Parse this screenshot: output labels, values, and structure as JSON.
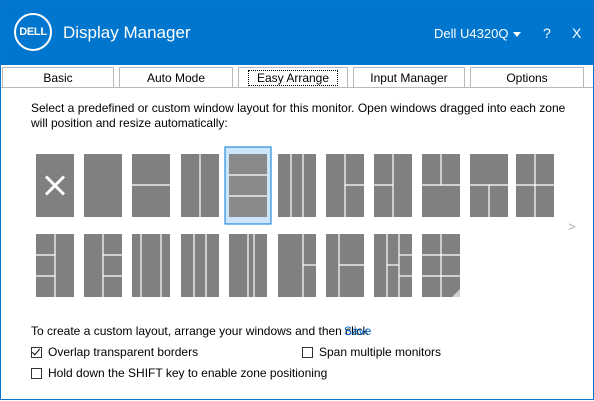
{
  "window": {
    "logo_text": "DELL",
    "title": "Display Manager",
    "monitor": "Dell U4320Q",
    "help_label": "?",
    "close_label": "X"
  },
  "tabs": [
    {
      "label": "Basic",
      "active": false
    },
    {
      "label": "Auto Mode",
      "active": false
    },
    {
      "label": "Easy Arrange",
      "active": true
    },
    {
      "label": "Input Manager",
      "active": false
    },
    {
      "label": "Options",
      "active": false
    }
  ],
  "description": "Select a predefined or custom window layout for this monitor.  Open windows dragged into each zone will position and resize automatically:",
  "layouts": {
    "selected_index": 4,
    "rows": 2,
    "per_row": [
      11,
      9
    ]
  },
  "next_arrow": ">",
  "custom_layout_text": "To create a custom layout, arrange your windows and then click",
  "save_label": "Save",
  "checkboxes": {
    "overlap": {
      "label": "Overlap transparent borders",
      "checked": true
    },
    "span": {
      "label": "Span multiple monitors",
      "checked": false
    },
    "shift": {
      "label": "Hold down the SHIFT key to enable zone positioning",
      "checked": false
    }
  },
  "colors": {
    "titlebar": "#0076ce",
    "tile": "#808080",
    "tile_line": "#ffffff",
    "selected_fill": "#cde6fb",
    "selected_border": "#0078d7",
    "link": "#0066cc"
  }
}
